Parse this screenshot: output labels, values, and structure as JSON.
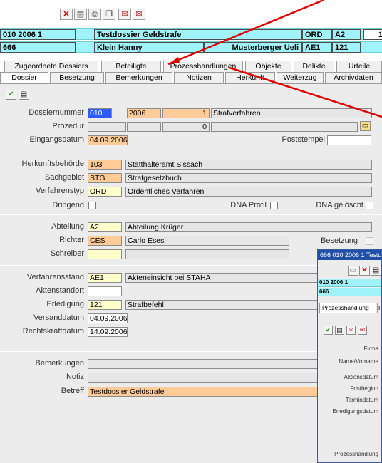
{
  "header": {
    "row1": {
      "number": "010 2006 1",
      "title": "Testdossier Geldstrafe",
      "code1": "ORD",
      "code2": "A2",
      "extra": "1"
    },
    "row2": {
      "number": "666",
      "person1": "Klein Hanny",
      "person2": "Musterberger Ueli",
      "code1": "AE1",
      "code2": "121"
    }
  },
  "tabs_upper": [
    "Zugeordnete Dossiers",
    "Beteiligte",
    "Prozesshandlungen",
    "Objekte",
    "Delikte",
    "Urteile"
  ],
  "tabs_lower": [
    "Dossier",
    "Besetzung",
    "Bemerkungen",
    "Notizen",
    "Herkunft",
    "Weiterzug",
    "Archivdaten"
  ],
  "form": {
    "dossiernummer": {
      "label": "Dossiernummer",
      "v1": "010",
      "v2": "2006",
      "v3": "1",
      "v4": "Strafverfahren"
    },
    "prozedur": {
      "label": "Prozedur",
      "v3": "0"
    },
    "eingangsdatum": {
      "label": "Eingangsdatum",
      "value": "04.09.2006"
    },
    "poststempel": {
      "label": "Poststempel"
    },
    "herkunftsbehoerde": {
      "label": "Herkunftsbehörde",
      "code": "103",
      "text": "Statthalteramt Sissach"
    },
    "sachgebiet": {
      "label": "Sachgebiet",
      "code": "STG",
      "text": "Strafgesetzbuch"
    },
    "verfahrenstyp": {
      "label": "Verfahrenstyp",
      "code": "ORD",
      "text": "Ordentliches Verfahren"
    },
    "dringend": {
      "label": "Dringend"
    },
    "dna_profil": {
      "label": "DNA Profil"
    },
    "dna_geloescht": {
      "label": "DNA gelöscht"
    },
    "abteilung": {
      "label": "Abteilung",
      "code": "A2",
      "text": "Abteilung Krüger"
    },
    "richter": {
      "label": "Richter",
      "code": "CES",
      "text": "Carlo Eses"
    },
    "besetzung": {
      "label": "Besetzung"
    },
    "schreiber": {
      "label": "Schreiber"
    },
    "verfahrensstand": {
      "label": "Verfahrensstand",
      "code": "AE1",
      "text": "Akteneinsicht bei STAHA"
    },
    "aktenstandort": {
      "label": "Aktenstandort"
    },
    "erledigung": {
      "label": "Erledigung",
      "code": "121",
      "text": "Strafbefehl"
    },
    "versanddatum": {
      "label": "Versanddatum",
      "value": "04.09.2006"
    },
    "rechtskraftdatum": {
      "label": "Rechtskraftdatum",
      "value": "14.09.2006"
    },
    "bemerkungen": {
      "label": "Bemerkungen"
    },
    "notiz": {
      "label": "Notiz"
    },
    "betreff": {
      "label": "Betreff",
      "value": "Testdossier Geldstrafe"
    }
  },
  "popup": {
    "title": "666 010 2006 1 Testd",
    "row1": "010 2006 1",
    "row2": "666",
    "tab": "Prozesshandlung",
    "tab_extra": "Fi",
    "labels": [
      "Firma",
      "Name/Vorname",
      "Aktionsdatum",
      "Fristbeginn",
      "Termindatum",
      "Erledigungsdatum",
      "Prozesshandlung"
    ]
  },
  "colors": {
    "header": "#9ff3f9",
    "orange_field": "#ffcb99",
    "yellow_field": "#ffffcc",
    "arrow": "#e00000"
  }
}
